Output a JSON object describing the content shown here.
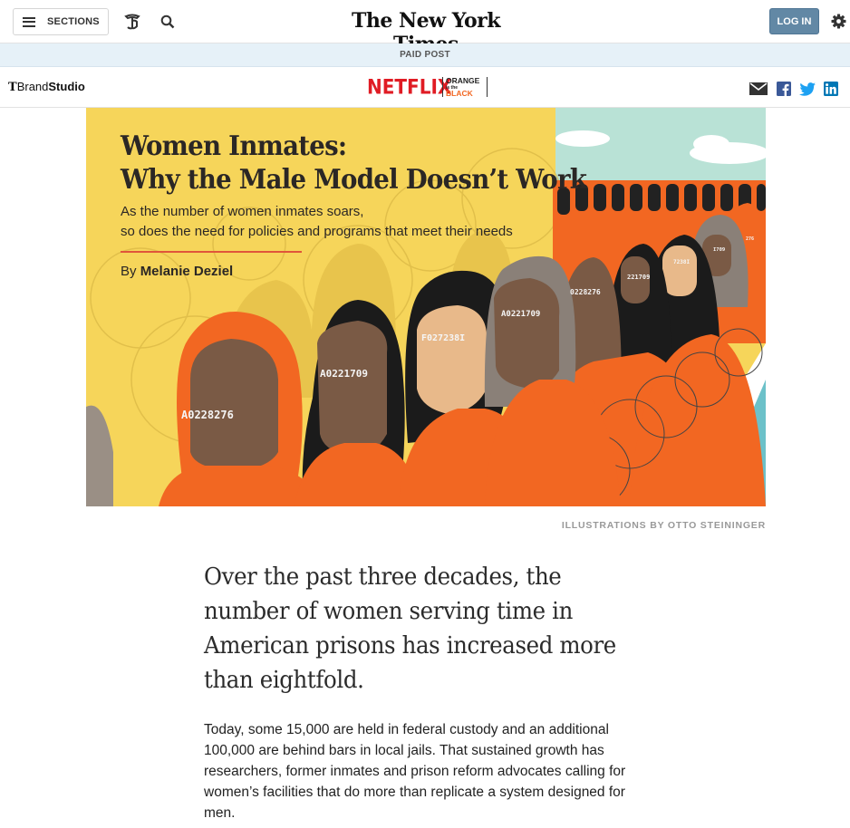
{
  "header": {
    "sections_label": "SECTIONS",
    "masthead_title": "The New York Times",
    "login_label": "LOG IN"
  },
  "paid_band": {
    "label": "PAID POST"
  },
  "brand_bar": {
    "brandstudio_t": "T",
    "brandstudio_brand": "Brand",
    "brandstudio_studio": "Studio",
    "sponsor": "NETFLIX",
    "show_line1": "ORANGE",
    "show_line2": "is the",
    "show_line3": "BLACK"
  },
  "hero": {
    "title_line1": "Women Inmates:",
    "title_line2": "Why the Male Model Doesn’t Work",
    "subtitle_line1": "As the number of women inmates soars,",
    "subtitle_line2": "so does the need for policies and programs that meet their needs",
    "byline_prefix": "By",
    "byline_author": "Melanie Deziel",
    "inmate_ids": [
      "A0228276",
      "A0221709",
      "F027238I",
      "A0221709",
      "0228276",
      "221709",
      "7238I",
      "I709",
      "276"
    ]
  },
  "credit": "ILLUSTRATIONS BY OTTO STEININGER",
  "article": {
    "lede": "Over the past three decades, the number of women serving time in American prisons has increased more than eightfold.",
    "paragraph1": "Today, some 15,000 are held in federal custody and an additional 100,000 are behind bars in local jails. That sustained growth has researchers, former inmates and prison reform advocates calling for women’s facilities that do more than replicate a system designed for men."
  },
  "colors": {
    "login_bg": "#6288a5",
    "paid_band_bg": "#e6f1f8",
    "netflix_red": "#e01c24",
    "hero_yellow": "#f6d55a",
    "jumpsuit_orange": "#f26722",
    "rule_red": "#e0553a"
  },
  "icons": [
    "hamburger-icon",
    "t-logo-icon",
    "search-icon",
    "gear-icon",
    "mail-icon",
    "facebook-icon",
    "twitter-icon",
    "linkedin-icon"
  ]
}
